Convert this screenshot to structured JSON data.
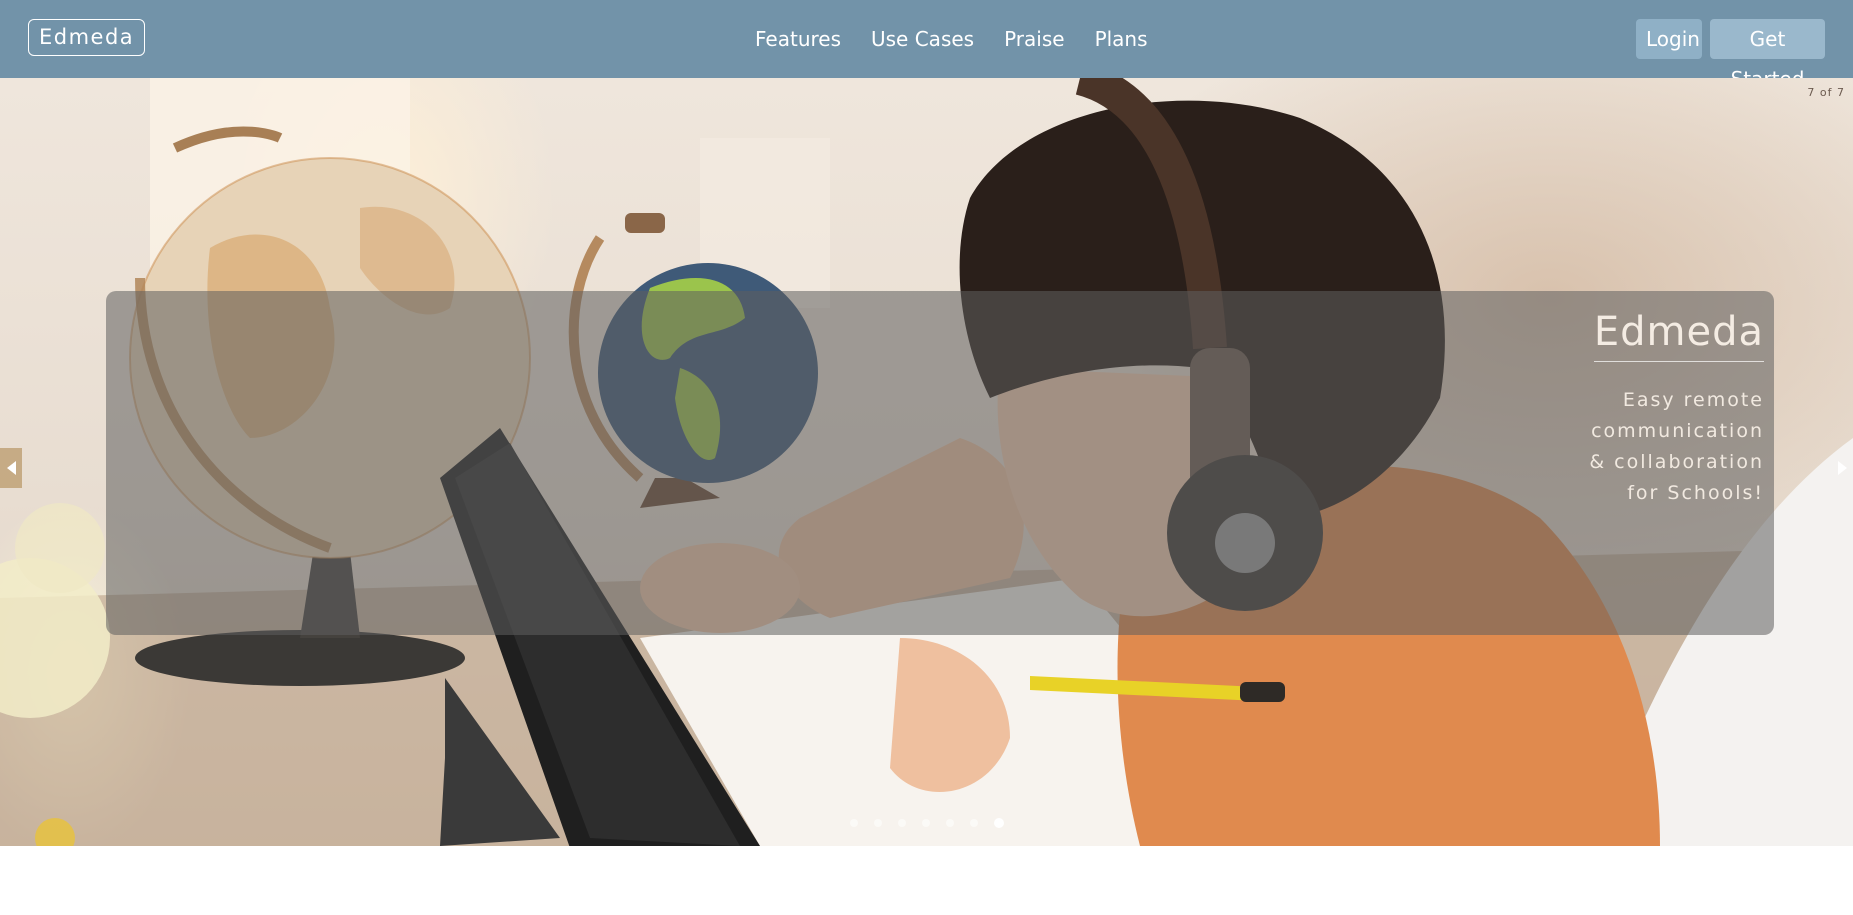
{
  "brand": {
    "name": "Edmeda"
  },
  "nav": {
    "items": [
      {
        "label": "Features"
      },
      {
        "label": "Use Cases"
      },
      {
        "label": "Praise"
      },
      {
        "label": "Plans"
      }
    ]
  },
  "auth": {
    "login_label": "Login",
    "get_started_label": "Get Started"
  },
  "hero": {
    "slide_counter": "7 of 7",
    "caption_title": "Edmeda",
    "caption_subtitle": "Easy remote communication & collaboration for Schools!",
    "slide_count": 7,
    "active_slide": 7,
    "image_description": "child with headphones using a tablet beside two desk globes"
  },
  "colors": {
    "navbar_bg": "#7293a9",
    "button_bg": "#8fb0c6",
    "caption_overlay": "rgba(95,95,95,0.55)"
  },
  "icons": {
    "prev": "chevron-left-icon",
    "next": "chevron-right-icon"
  }
}
